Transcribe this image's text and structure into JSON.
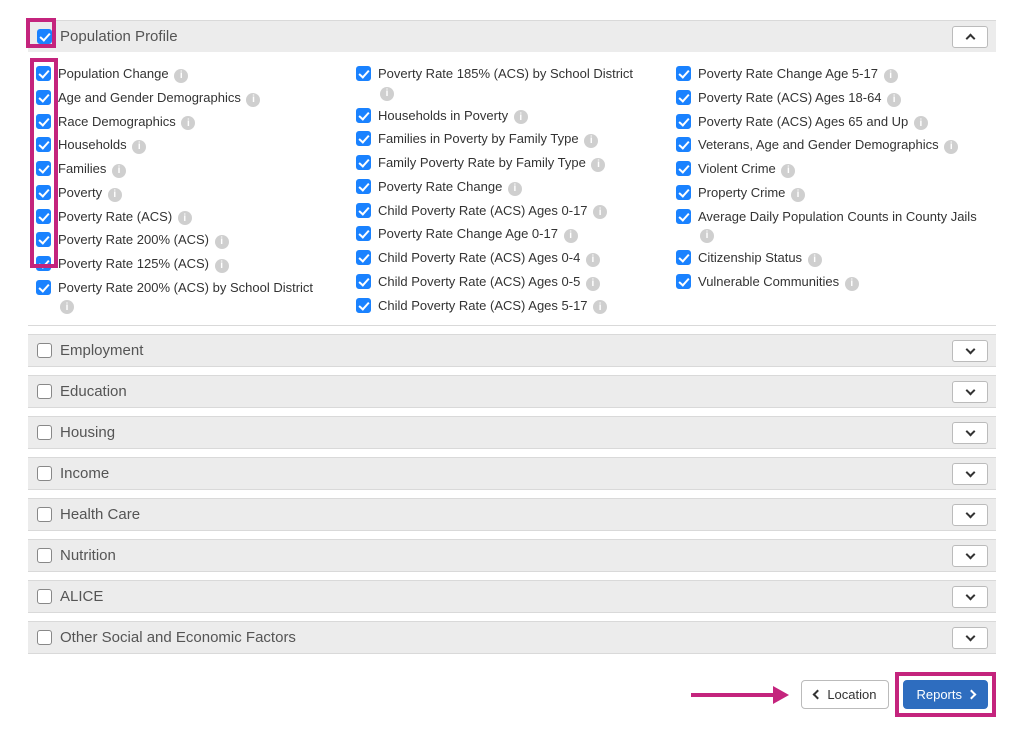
{
  "sections": [
    {
      "id": "population-profile",
      "title": "Population Profile",
      "checked": true,
      "expanded": true,
      "highlighted": true,
      "columns": [
        [
          {
            "label": "Population Change",
            "checked": true,
            "info": true
          },
          {
            "label": "Age and Gender Demographics",
            "checked": true,
            "info": true
          },
          {
            "label": "Race Demographics",
            "checked": true,
            "info": true
          },
          {
            "label": "Households",
            "checked": true,
            "info": true
          },
          {
            "label": "Families",
            "checked": true,
            "info": true
          },
          {
            "label": "Poverty",
            "checked": true,
            "info": true
          },
          {
            "label": "Poverty Rate (ACS)",
            "checked": true,
            "info": true
          },
          {
            "label": "Poverty Rate 200% (ACS)",
            "checked": true,
            "info": true
          },
          {
            "label": "Poverty Rate 125% (ACS)",
            "checked": true,
            "info": true
          },
          {
            "label": "Poverty Rate 200% (ACS) by School District",
            "checked": true,
            "info": true,
            "info_below": true
          }
        ],
        [
          {
            "label": "Poverty Rate 185% (ACS) by School District",
            "checked": true,
            "info": true,
            "info_below": true
          },
          {
            "label": "Households in Poverty",
            "checked": true,
            "info": true
          },
          {
            "label": "Families in Poverty by Family Type",
            "checked": true,
            "info": true
          },
          {
            "label": "Family Poverty Rate by Family Type",
            "checked": true,
            "info": true
          },
          {
            "label": "Poverty Rate Change",
            "checked": true,
            "info": true
          },
          {
            "label": "Child Poverty Rate (ACS) Ages 0-17",
            "checked": true,
            "info": true
          },
          {
            "label": "Poverty Rate Change Age 0-17",
            "checked": true,
            "info": true
          },
          {
            "label": "Child Poverty Rate (ACS) Ages 0-4",
            "checked": true,
            "info": true
          },
          {
            "label": "Child Poverty Rate (ACS) Ages 0-5",
            "checked": true,
            "info": true
          },
          {
            "label": "Child Poverty Rate (ACS) Ages 5-17",
            "checked": true,
            "info": true
          }
        ],
        [
          {
            "label": "Poverty Rate Change Age 5-17",
            "checked": true,
            "info": true
          },
          {
            "label": "Poverty Rate (ACS) Ages 18-64",
            "checked": true,
            "info": true
          },
          {
            "label": "Poverty Rate (ACS) Ages 65 and Up",
            "checked": true,
            "info": true
          },
          {
            "label": "Veterans, Age and Gender Demographics",
            "checked": true,
            "info": true
          },
          {
            "label": "Violent Crime",
            "checked": true,
            "info": true
          },
          {
            "label": "Property Crime",
            "checked": true,
            "info": true
          },
          {
            "label": "Average Daily Population Counts in County Jails",
            "checked": true,
            "info": true,
            "info_below": true
          },
          {
            "label": "Citizenship Status",
            "checked": true,
            "info": true
          },
          {
            "label": "Vulnerable Communities",
            "checked": true,
            "info": true
          }
        ]
      ]
    },
    {
      "id": "employment",
      "title": "Employment",
      "checked": false,
      "expanded": false
    },
    {
      "id": "education",
      "title": "Education",
      "checked": false,
      "expanded": false
    },
    {
      "id": "housing",
      "title": "Housing",
      "checked": false,
      "expanded": false
    },
    {
      "id": "income",
      "title": "Income",
      "checked": false,
      "expanded": false
    },
    {
      "id": "health-care",
      "title": "Health Care",
      "checked": false,
      "expanded": false
    },
    {
      "id": "nutrition",
      "title": "Nutrition",
      "checked": false,
      "expanded": false
    },
    {
      "id": "alice",
      "title": "ALICE",
      "checked": false,
      "expanded": false
    },
    {
      "id": "other-social",
      "title": "Other Social and Economic Factors",
      "checked": false,
      "expanded": false
    }
  ],
  "footer": {
    "location_label": "Location",
    "reports_label": "Reports"
  },
  "info_glyph": "i"
}
